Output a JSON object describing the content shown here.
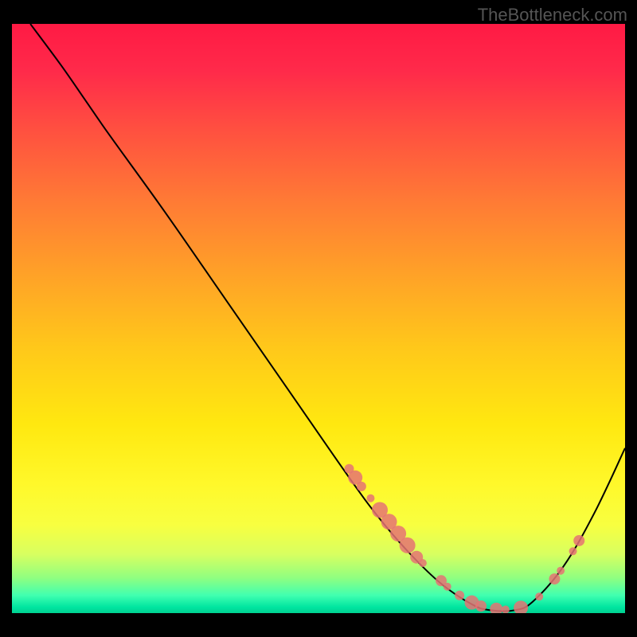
{
  "watermark": "TheBottleneck.com",
  "chart_data": {
    "type": "line",
    "title": "",
    "xlabel": "",
    "ylabel": "",
    "xlim": [
      0,
      100
    ],
    "ylim": [
      0,
      100
    ],
    "grid": false,
    "legend": false,
    "curve_points": [
      {
        "x": 3,
        "y": 100
      },
      {
        "x": 8,
        "y": 93
      },
      {
        "x": 12,
        "y": 87
      },
      {
        "x": 16,
        "y": 81
      },
      {
        "x": 25,
        "y": 68
      },
      {
        "x": 35,
        "y": 53
      },
      {
        "x": 45,
        "y": 38
      },
      {
        "x": 55,
        "y": 23
      },
      {
        "x": 60,
        "y": 16
      },
      {
        "x": 65,
        "y": 10
      },
      {
        "x": 70,
        "y": 5
      },
      {
        "x": 75,
        "y": 1.5
      },
      {
        "x": 78,
        "y": 0.5
      },
      {
        "x": 82,
        "y": 0.5
      },
      {
        "x": 85,
        "y": 2
      },
      {
        "x": 90,
        "y": 8
      },
      {
        "x": 95,
        "y": 17
      },
      {
        "x": 100,
        "y": 28
      }
    ],
    "marker_points": [
      {
        "x": 55,
        "y": 24.5,
        "size": 6
      },
      {
        "x": 56,
        "y": 23,
        "size": 9
      },
      {
        "x": 57,
        "y": 21.5,
        "size": 6
      },
      {
        "x": 58.5,
        "y": 19.5,
        "size": 5
      },
      {
        "x": 60,
        "y": 17.5,
        "size": 10
      },
      {
        "x": 61.5,
        "y": 15.5,
        "size": 10
      },
      {
        "x": 63,
        "y": 13.5,
        "size": 10
      },
      {
        "x": 64.5,
        "y": 11.5,
        "size": 10
      },
      {
        "x": 66,
        "y": 9.5,
        "size": 8
      },
      {
        "x": 67,
        "y": 8.5,
        "size": 5
      },
      {
        "x": 70,
        "y": 5.5,
        "size": 7
      },
      {
        "x": 71,
        "y": 4.5,
        "size": 5
      },
      {
        "x": 73,
        "y": 3,
        "size": 6
      },
      {
        "x": 75,
        "y": 1.8,
        "size": 9
      },
      {
        "x": 76.5,
        "y": 1.2,
        "size": 7
      },
      {
        "x": 79,
        "y": 0.7,
        "size": 8
      },
      {
        "x": 80.5,
        "y": 0.6,
        "size": 5
      },
      {
        "x": 83,
        "y": 0.9,
        "size": 9
      },
      {
        "x": 86,
        "y": 2.8,
        "size": 5
      },
      {
        "x": 88.5,
        "y": 5.8,
        "size": 7
      },
      {
        "x": 89.5,
        "y": 7.2,
        "size": 5
      },
      {
        "x": 91.5,
        "y": 10.5,
        "size": 5
      },
      {
        "x": 92.5,
        "y": 12.3,
        "size": 7
      }
    ]
  }
}
